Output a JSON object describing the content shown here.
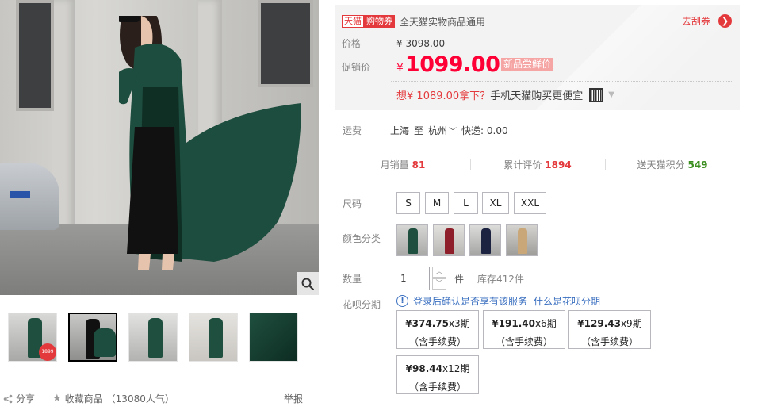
{
  "gallery": {
    "thumbnails": [
      {
        "label": "thumb-1",
        "badge_text": "1899"
      },
      {
        "label": "thumb-2"
      },
      {
        "label": "thumb-3"
      },
      {
        "label": "thumb-4"
      },
      {
        "label": "thumb-5"
      }
    ],
    "active_thumb": 1,
    "icons": {
      "zoom": "magnifier-icon"
    }
  },
  "actions": {
    "share": "分享",
    "favorite": "收藏商品",
    "favorite_count": "（13080人气）",
    "report": "举报"
  },
  "coupon": {
    "tmall_tag": "天猫",
    "coupon_tag": "购物券",
    "text": "全天猫实物商品通用",
    "get_label": "去刮券"
  },
  "price": {
    "label": "价格",
    "original": "¥ 3098.00",
    "promo_label": "促销价",
    "currency": "¥",
    "promo": "1099.00",
    "promo_tag": "新品尝鲜价"
  },
  "app_promo": {
    "prefix": "想",
    "amount": "¥ 1089.00拿下？",
    "suffix": "手机天猫购买更便宜"
  },
  "shipping": {
    "label": "运费",
    "from": "上海",
    "to_word": "至",
    "to": "杭州",
    "express": "快递: 0.00"
  },
  "stats": [
    {
      "label": "月销量",
      "value": "81"
    },
    {
      "label": "累计评价",
      "value": "1894"
    },
    {
      "label": "送天猫积分",
      "value": "549"
    }
  ],
  "size": {
    "label": "尺码",
    "options": [
      "S",
      "M",
      "L",
      "XL",
      "XXL"
    ]
  },
  "color": {
    "label": "颜色分类",
    "swatch_count": 4
  },
  "quantity": {
    "label": "数量",
    "value": "1",
    "unit": "件",
    "stock": "库存412件"
  },
  "huabei": {
    "label": "花呗分期",
    "notice": "登录后确认是否享有该服务",
    "link": "什么是花呗分期",
    "plans": [
      {
        "amount": "¥374.75",
        "periods": "x3期",
        "fee": "（含手续费）"
      },
      {
        "amount": "¥191.40",
        "periods": "x6期",
        "fee": "（含手续费）"
      },
      {
        "amount": "¥129.43",
        "periods": "x9期",
        "fee": "（含手续费）"
      },
      {
        "amount": "¥98.44",
        "periods": "x12期",
        "fee": "（含手续费）"
      }
    ]
  },
  "colors": {
    "accent_red": "#e4393c",
    "price_red": "#ff0036",
    "link_blue": "#3a6fc0",
    "points_green": "#3a8e1e",
    "coat_green": "#1f4f3f"
  }
}
